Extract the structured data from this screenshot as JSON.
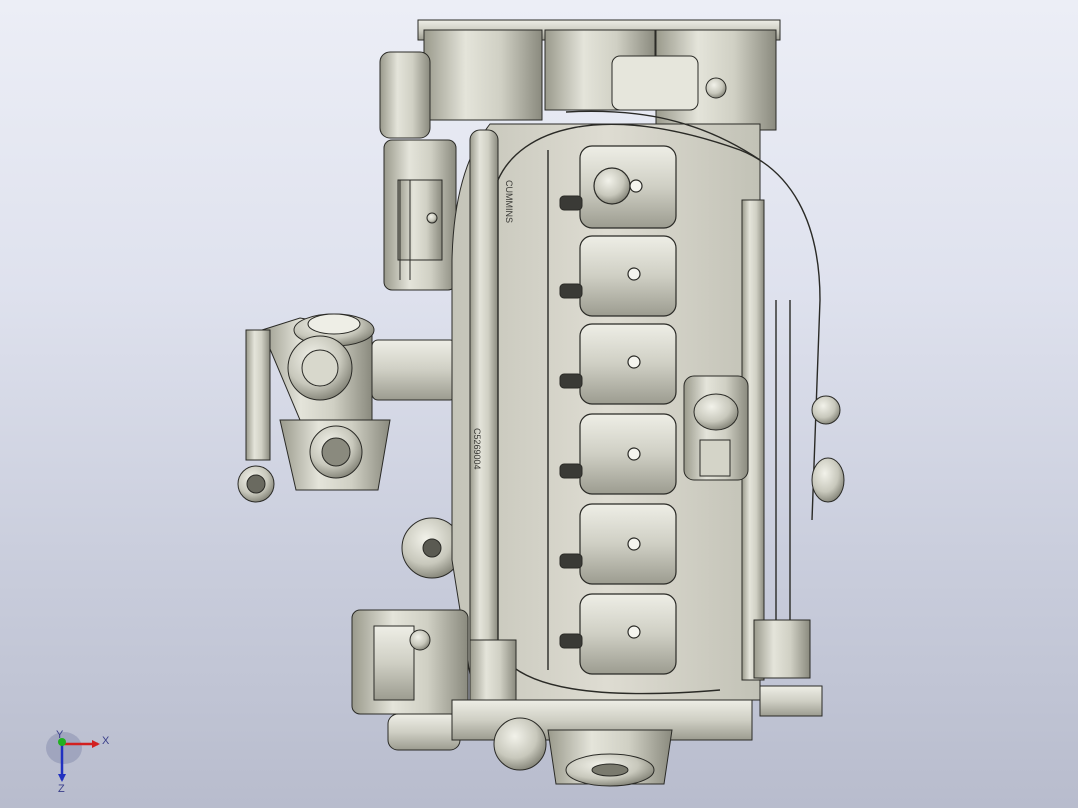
{
  "viewport": {
    "background_top": "#eceef6",
    "background_bottom": "#b8bccd"
  },
  "model": {
    "component": "engine-assembly",
    "casting_text_1": "CUMMINS",
    "casting_text_2": "C5269004"
  },
  "triad": {
    "x_label": "X",
    "y_label": "Y",
    "z_label": "Z",
    "x_color": "#d22020",
    "y_color": "#20b020",
    "z_color": "#2030c0"
  }
}
